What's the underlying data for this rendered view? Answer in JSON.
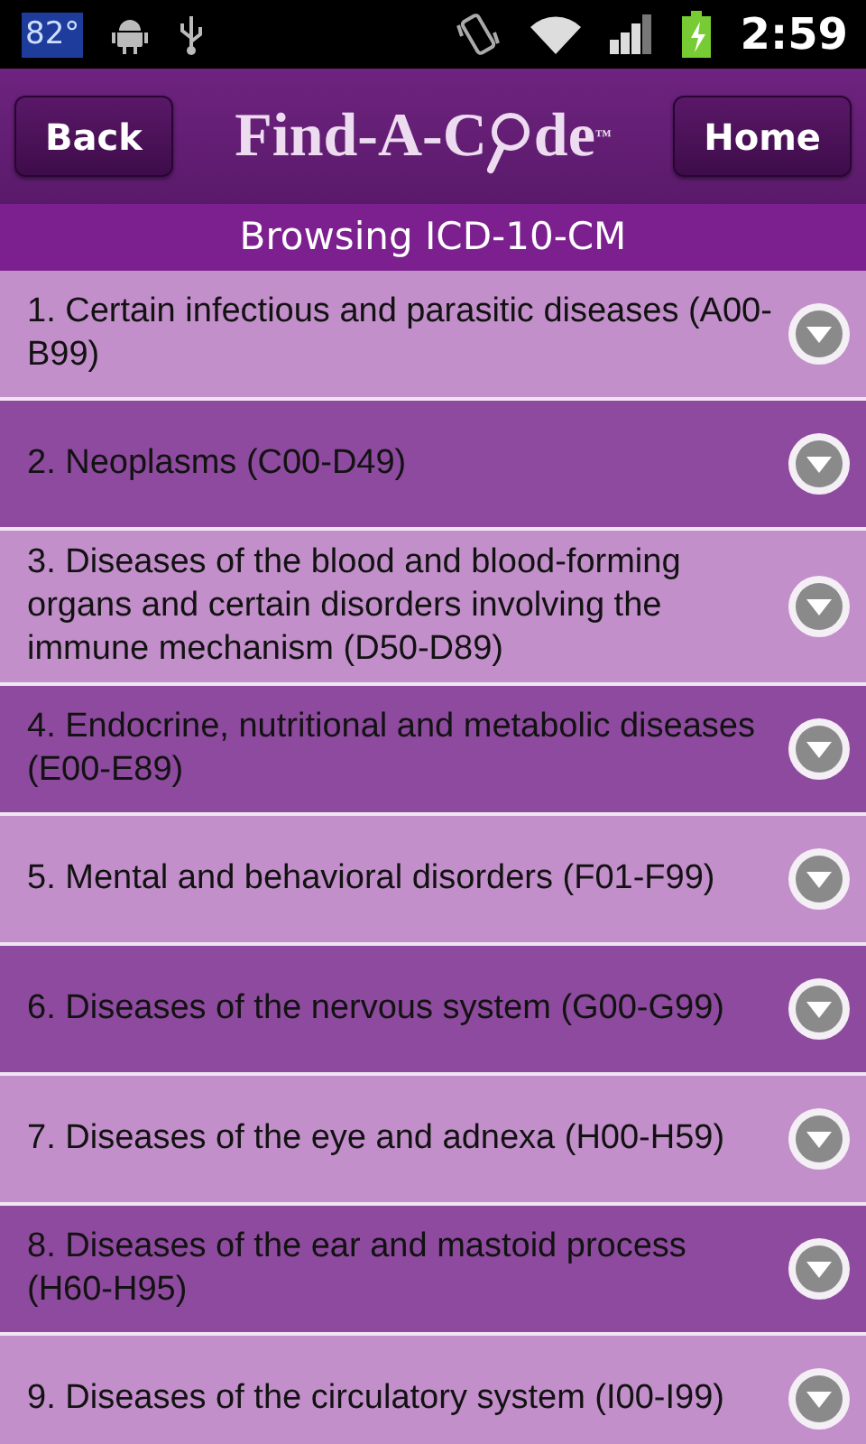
{
  "status_bar": {
    "temperature": "82°",
    "time": "2:59"
  },
  "header": {
    "back_button": "Back",
    "logo": {
      "before": "Find-A-C",
      "after": "de",
      "trademark": "™"
    },
    "home_button": "Home"
  },
  "subtitle": "Browsing ICD-10-CM",
  "chapters": [
    {
      "label": "1. Certain infectious and parasitic diseases (A00-B99)"
    },
    {
      "label": "2. Neoplasms (C00-D49)"
    },
    {
      "label": "3. Diseases of the blood and blood-forming organs and certain disorders involving the immune mechanism (D50-D89)"
    },
    {
      "label": "4. Endocrine, nutritional and metabolic diseases (E00-E89)"
    },
    {
      "label": "5. Mental and behavioral disorders (F01-F99)"
    },
    {
      "label": "6. Diseases of the nervous system (G00-G99)"
    },
    {
      "label": "7. Diseases of the eye and adnexa (H00-H59)"
    },
    {
      "label": "8. Diseases of the ear and mastoid process (H60-H95)"
    },
    {
      "label": "9. Diseases of the circulatory system (I00-I99)"
    }
  ]
}
